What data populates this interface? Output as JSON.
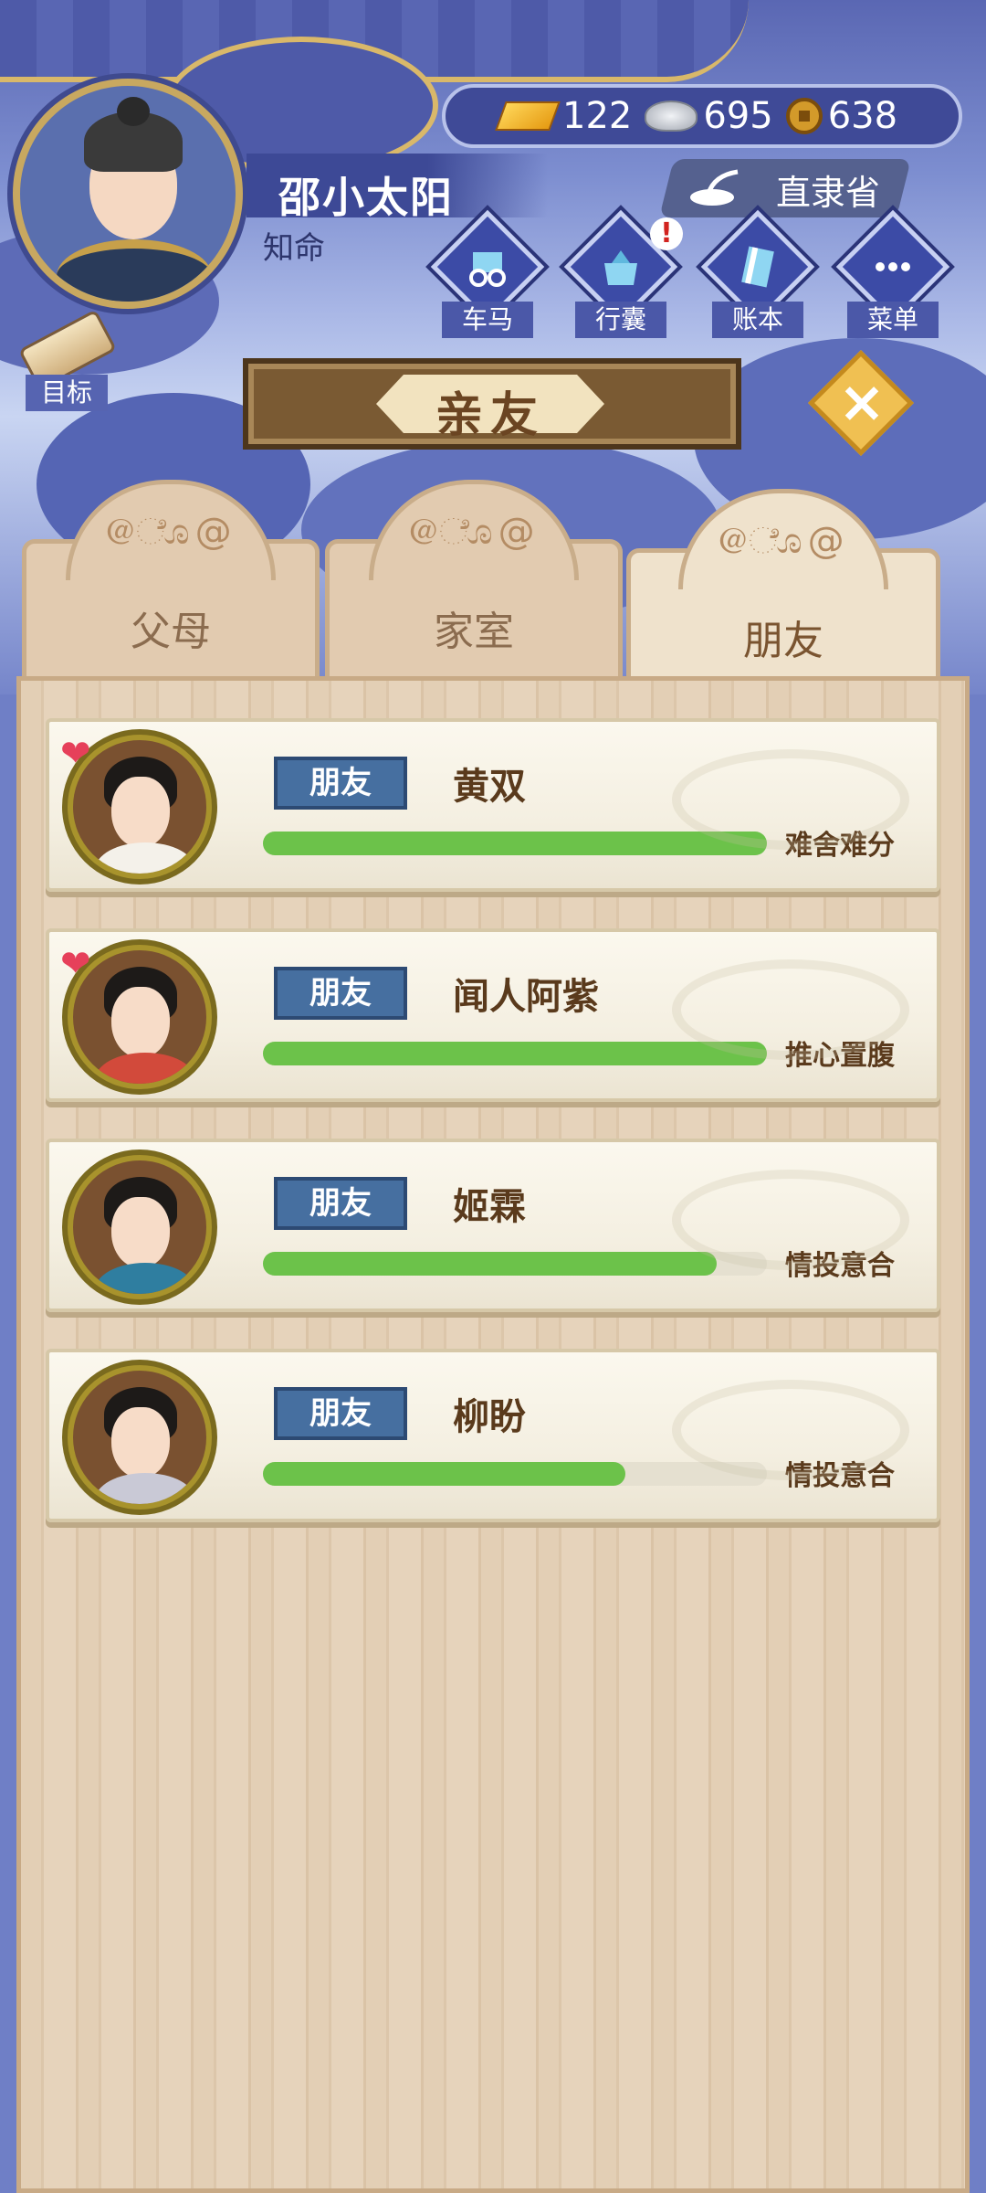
{
  "player": {
    "name": "邵小太阳",
    "title": "知命"
  },
  "currency": {
    "gold": "122",
    "silver": "695",
    "copper": "638"
  },
  "location": "直隶省",
  "menu": [
    {
      "label": "车马",
      "icon": "carriage-icon",
      "alert": false
    },
    {
      "label": "行囊",
      "icon": "bundle-icon",
      "alert": true
    },
    {
      "label": "账本",
      "icon": "ledger-icon",
      "alert": false
    },
    {
      "label": "菜单",
      "icon": "more-icon",
      "alert": false
    }
  ],
  "alert_mark": "!",
  "goal_label": "目标",
  "panel_title": "亲友",
  "tabs": [
    {
      "label": "父母",
      "active": false
    },
    {
      "label": "家室",
      "active": false
    },
    {
      "label": "朋友",
      "active": true
    }
  ],
  "friends": [
    {
      "tag": "朋友",
      "name": "黄双",
      "relation": "难舍难分",
      "progress": 1.0,
      "heart": true,
      "robe_color": "#f4f1ea",
      "hair_color": "#1d1a18"
    },
    {
      "tag": "朋友",
      "name": "闻人阿紫",
      "relation": "推心置腹",
      "progress": 1.0,
      "heart": true,
      "robe_color": "#d24a3b",
      "hair_color": "#1d1a18"
    },
    {
      "tag": "朋友",
      "name": "姬霖",
      "relation": "情投意合",
      "progress": 0.9,
      "heart": false,
      "robe_color": "#2f7ea0",
      "hair_color": "#1d1a18"
    },
    {
      "tag": "朋友",
      "name": "柳盼",
      "relation": "情投意合",
      "progress": 0.72,
      "heart": false,
      "robe_color": "#c9c9d6",
      "hair_color": "#1d1a18"
    }
  ],
  "colors": {
    "progress": "#6cc24a",
    "badge": "#466fa0",
    "accent_gold": "#f0c052"
  }
}
